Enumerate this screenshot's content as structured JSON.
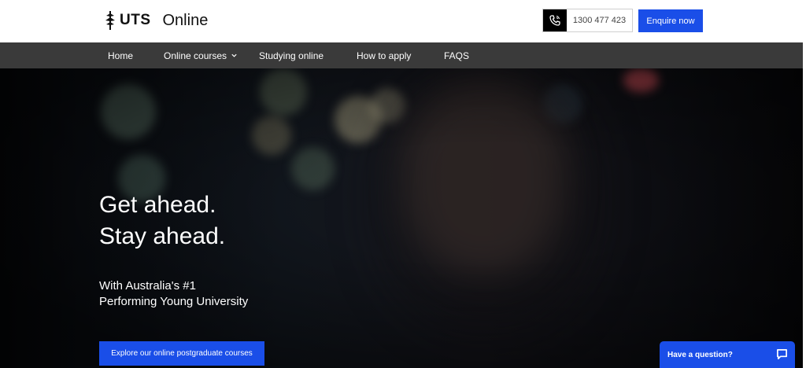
{
  "header": {
    "logo": {
      "brand": "UTS",
      "product": "Online",
      "icon": "uts-logo-icon"
    },
    "phone": {
      "number": "1300 477 423",
      "icon": "phone-icon"
    },
    "enquire_label": "Enquire now"
  },
  "nav": {
    "items": [
      {
        "label": "Home"
      },
      {
        "label": "Online courses",
        "icon": "chevron-down-icon"
      },
      {
        "label": "Studying online"
      },
      {
        "label": "How to apply"
      },
      {
        "label": "FAQS"
      }
    ]
  },
  "hero": {
    "headline_1": "Get ahead.",
    "headline_2": "Stay ahead.",
    "subline_1": "With Australia's #1",
    "subline_2": "Performing Young University",
    "cta_label": "Explore our online postgraduate courses"
  },
  "chat": {
    "label": "Have a question?",
    "icon": "chat-bubble-icon"
  },
  "colors": {
    "accent": "#1a4ee8",
    "nav_bg": "#3a3a3a",
    "hero_bg": "#0b0d12"
  }
}
